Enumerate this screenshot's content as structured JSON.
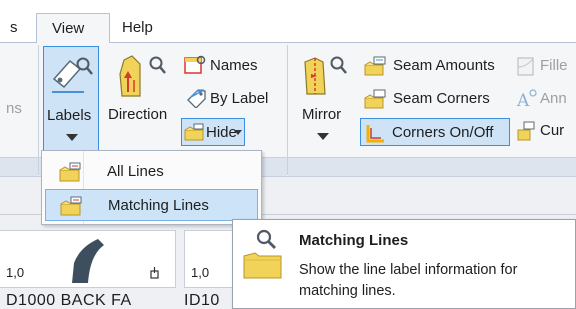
{
  "tabs": {
    "partial": "s",
    "view": "View",
    "help": "Help"
  },
  "ribbon": {
    "left_cut_text": "ns",
    "labels_button": "Labels",
    "direction_button": "Direction",
    "names_button": "Names",
    "by_label_button": "By Label",
    "hide_button": "Hide",
    "mirror_button": "Mirror",
    "seam_amounts_button": "Seam Amounts",
    "seam_corners_button": "Seam Corners",
    "corners_onoff_button": "Corners On/Off",
    "fille_cut": "Fille",
    "ann_cut": "Ann",
    "cur_cut": "Cur"
  },
  "dropdown": {
    "items": [
      {
        "label": "All Lines",
        "icon": "folder-pencil-icon",
        "hovered": false
      },
      {
        "label": "Matching Lines",
        "icon": "folder-pencil-icon",
        "hovered": true
      }
    ]
  },
  "tooltip": {
    "title": "Matching Lines",
    "body": "Show the line label information for matching lines."
  },
  "pieces": {
    "label_a": "1,0",
    "label_b": "1,0",
    "bottom_text_a": "D1000 BACK FA",
    "bottom_text_b": "ID10"
  },
  "colors": {
    "accent": "#3b8ee0",
    "pressed_fill": "#cfe3f7",
    "icon_yellow": "#f2d35a",
    "shape_dark": "#3d4f5e"
  }
}
